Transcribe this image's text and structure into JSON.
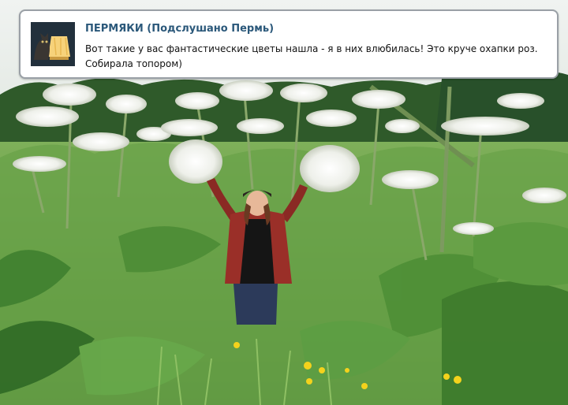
{
  "post": {
    "author": "ПЕРМЯКИ (Подслушано Пермь)",
    "text": "Вот такие у вас фантастические цветы нашла - я в них влюбилась! Это круче охапки роз. Собирала топором)"
  },
  "colors": {
    "author_link": "#2b587a",
    "card_border": "#9aa0a6",
    "foliage": "#6f9a52",
    "sky": "#e8ece8"
  },
  "icons": {
    "avatar": "cat-with-lamp-avatar"
  }
}
